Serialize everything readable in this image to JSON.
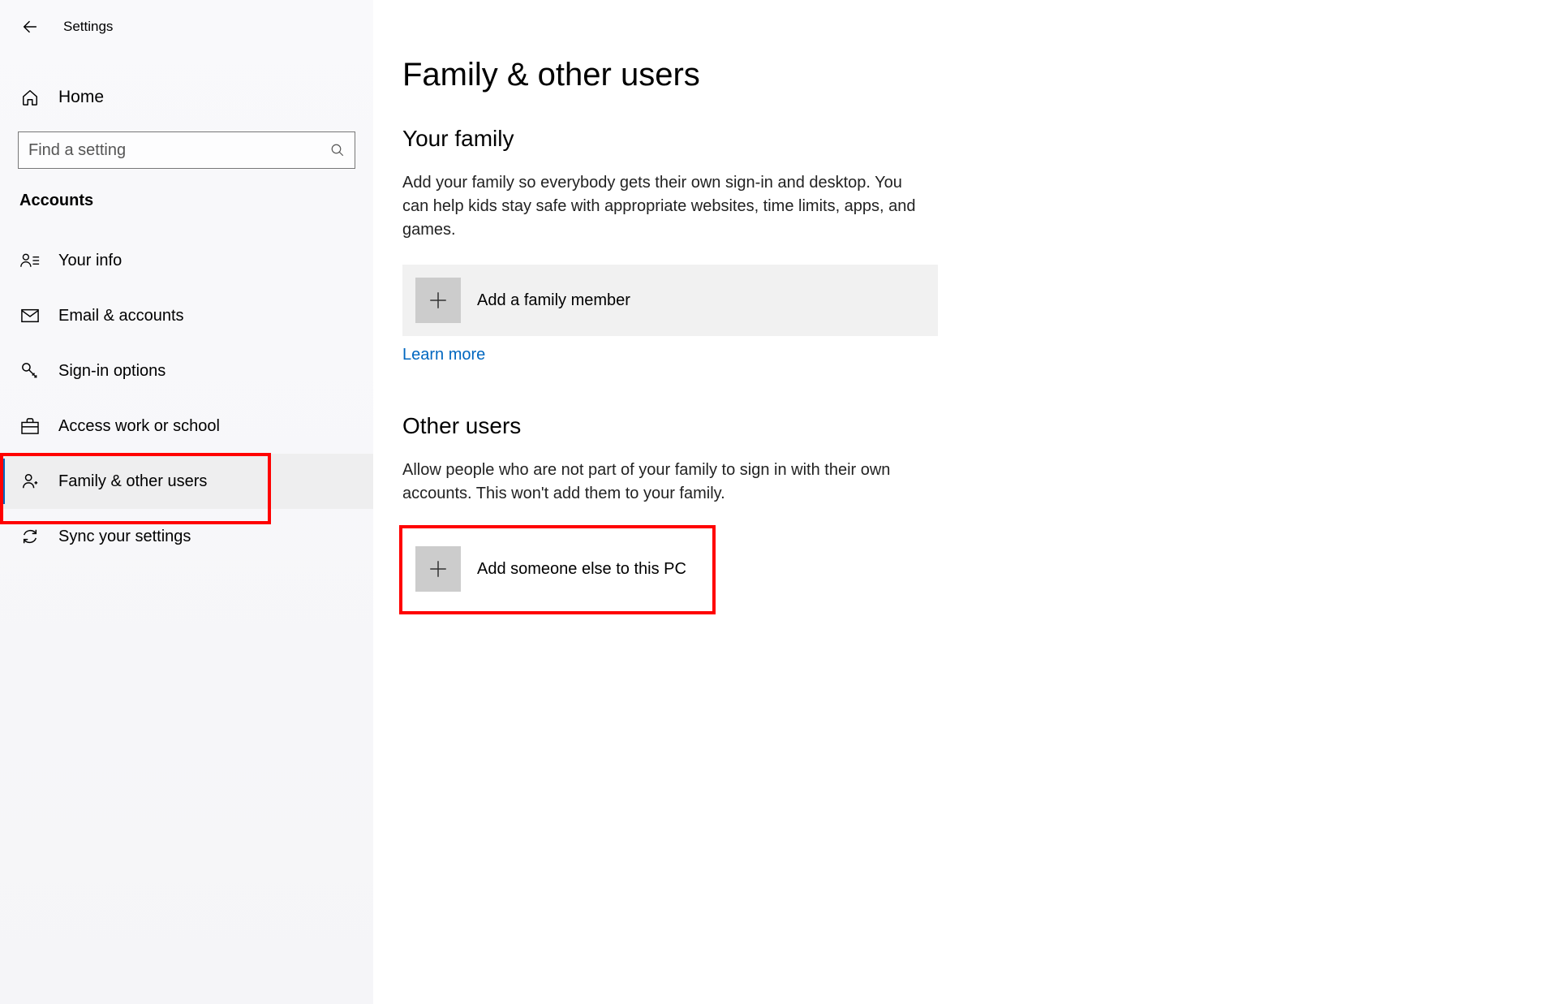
{
  "titlebar": {
    "title": "Settings"
  },
  "sidebar": {
    "home_label": "Home",
    "search_placeholder": "Find a setting",
    "section_label": "Accounts",
    "items": [
      {
        "label": "Your info"
      },
      {
        "label": "Email & accounts"
      },
      {
        "label": "Sign-in options"
      },
      {
        "label": "Access work or school"
      },
      {
        "label": "Family & other users"
      },
      {
        "label": "Sync your settings"
      }
    ]
  },
  "content": {
    "page_title": "Family & other users",
    "family": {
      "heading": "Your family",
      "description": "Add your family so everybody gets their own sign-in and desktop. You can help kids stay safe with appropriate websites, time limits, apps, and games.",
      "add_label": "Add a family member",
      "learn_more": "Learn more"
    },
    "other": {
      "heading": "Other users",
      "description": "Allow people who are not part of your family to sign in with their own accounts. This won't add them to your family.",
      "add_label": "Add someone else to this PC"
    }
  }
}
